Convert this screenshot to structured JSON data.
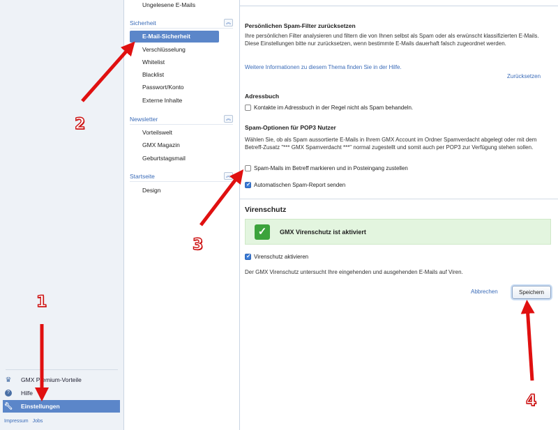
{
  "left_nav": {
    "items": [
      {
        "label": "GMX Premium-Vorteile",
        "icon": "crown-icon"
      },
      {
        "label": "Hilfe",
        "icon": "help-icon"
      },
      {
        "label": "Einstellungen",
        "icon": "wrench-icon"
      }
    ],
    "footer": {
      "impressum": "Impressum",
      "jobs": "Jobs"
    }
  },
  "sub_nav": {
    "top_item": "Ungelesene E-Mails",
    "groups": [
      {
        "title": "Sicherheit",
        "items": [
          "E-Mail-Sicherheit",
          "Verschlüsselung",
          "Whitelist",
          "Blacklist",
          "Passwort/Konto",
          "Externe Inhalte"
        ]
      },
      {
        "title": "Newsletter",
        "items": [
          "Vorteilswelt",
          "GMX Magazin",
          "Geburtstagsmail"
        ]
      },
      {
        "title": "Startseite",
        "items": [
          "Design"
        ]
      }
    ]
  },
  "main": {
    "reset": {
      "title": "Persönlichen Spam-Filter zurücksetzen",
      "text": "Ihre persönlichen Filter analysieren und filtern die von Ihnen selbst als Spam oder als erwünscht klassifizierten E-Mails. Diese Einstellungen bitte nur zurücksetzen, wenn bestimmte E-Mails dauerhaft falsch zugeordnet werden.",
      "help_link": "Weitere Informationen zu diesem Thema finden Sie in der Hilfe.",
      "reset_link": "Zurücksetzen"
    },
    "addressbook": {
      "title": "Adressbuch",
      "checkbox_label": "Kontakte im Adressbuch in der Regel nicht als Spam behandeln.",
      "checked": false
    },
    "pop3": {
      "title": "Spam-Optionen für POP3 Nutzer",
      "text": "Wählen Sie, ob als Spam aussortierte E-Mails in Ihrem GMX Account im Ordner Spamverdacht abgelegt oder mit dem Betreff-Zusatz \"*** GMX Spamverdacht ***\" normal zugestellt und somit auch per POP3 zur Verfügung stehen sollen.",
      "option1": {
        "label": "Spam-Mails im Betreff markieren und in Posteingang zustellen",
        "checked": false
      },
      "option2": {
        "label": "Automatischen Spam-Report senden",
        "checked": true
      }
    },
    "virus": {
      "title": "Virenschutz",
      "status": "GMX Virenschutz ist aktiviert",
      "checkbox_label": "Virenschutz aktivieren",
      "checked": true,
      "text": "Der GMX Virenschutz untersucht Ihre eingehenden und ausgehenden E-Mails auf Viren."
    },
    "buttons": {
      "cancel": "Abbrechen",
      "save": "Speichern"
    }
  },
  "annotations": [
    "1",
    "2",
    "3",
    "4"
  ],
  "colors": {
    "accent": "#5b86c9",
    "arrow": "#e01010",
    "success": "#3ca33c"
  }
}
